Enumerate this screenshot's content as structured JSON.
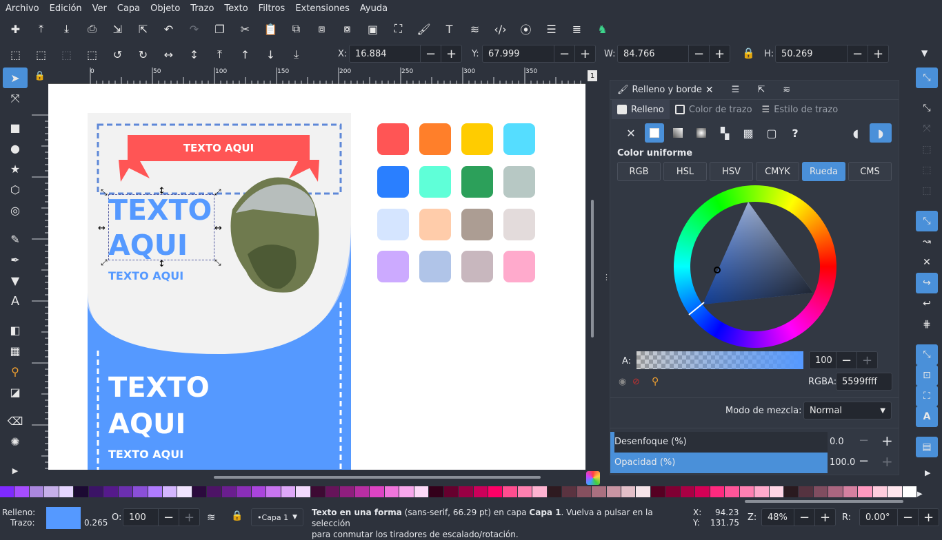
{
  "menu": [
    "Archivo",
    "Edición",
    "Ver",
    "Capa",
    "Objeto",
    "Trazo",
    "Texto",
    "Filtros",
    "Extensiones",
    "Ayuda"
  ],
  "toolbar": {
    "x_label": "X:",
    "x_value": "16.884",
    "y_label": "Y:",
    "y_value": "67.999",
    "w_label": "W:",
    "w_value": "84.766",
    "h_label": "H:",
    "h_value": "50.269"
  },
  "ruler": {
    "h_ticks": [
      "0",
      "50",
      "100",
      "150",
      "200",
      "250",
      "300",
      "350"
    ],
    "page_num": "1"
  },
  "canvas": {
    "banner_text": "TEXTO AQUI",
    "title_text_1": "TEXTO",
    "title_text_2": "AQUI",
    "subtitle_text": "TEXTO AQUI",
    "bottom_title_1": "TEXTO",
    "bottom_title_2": "AQUI",
    "bottom_subtitle": "TEXTO AQUI",
    "swatches": [
      "#ff5555",
      "#ff7f2a",
      "#ffcc00",
      "#55ddff",
      "#2a7fff",
      "#5fffd8",
      "#2ca05a",
      "#b7c8c4",
      "#d5e5ff",
      "#ffccaa",
      "#ac9d93",
      "#e3dbdb",
      "#ccaaff",
      "#b0c4e8",
      "#c8b7be",
      "#ffaacc"
    ]
  },
  "panel": {
    "tab_title": "Relleno y borde",
    "subtabs": [
      "Relleno",
      "Color de trazo",
      "Estilo de trazo"
    ],
    "section": "Color uniforme",
    "color_modes": [
      "RGB",
      "HSL",
      "HSV",
      "CMYK",
      "Rueda",
      "CMS"
    ],
    "active_mode": "Rueda",
    "alpha_label": "A:",
    "alpha_value": "100",
    "rgba_label": "RGBA:",
    "rgba_value": "5599ffff",
    "blend_label": "Modo de mezcla:",
    "blend_value": "Normal",
    "blur_label": "Desenfoque (%)",
    "blur_value": "0.0",
    "opacity_label": "Opacidad (%)",
    "opacity_value": "100.0",
    "opacity_fraction": 1.0,
    "fill_color": "#5599ff"
  },
  "status": {
    "fill_label": "Relleno:",
    "stroke_label": "Trazo:",
    "stroke_width": "0.265",
    "o_label": "O:",
    "o_value": "100",
    "layer": "•Capa 1",
    "msg_bold": "Texto en una forma",
    "msg_1": " (sans-serif, 66.29 pt) en capa ",
    "msg_layer": "Capa 1",
    "msg_2": ". Vuelva a pulsar en la selección",
    "msg_3": "para conmutar los tiradores de escalado/rotación.",
    "x_label": "X:",
    "x_value": "94.23",
    "y_label": "Y:",
    "y_value": "131.75",
    "z_label": "Z:",
    "z_value": "48%",
    "r_label": "R:",
    "r_value": "0.00°"
  },
  "palette_colors": [
    "#7f2aff",
    "#a64dff",
    "#aa87de",
    "#c6afe9",
    "#e5d5ff",
    "#1c0a33",
    "#3b1466",
    "#551a8b",
    "#6b2fb0",
    "#8a4fd8",
    "#b07cff",
    "#d4b6ff",
    "#f0e4ff",
    "#2b0a3d",
    "#4d1466",
    "#6a1e8f",
    "#8a2eb8",
    "#aa44dd",
    "#c875f0",
    "#dea7f8",
    "#f2d9fd",
    "#3d0a33",
    "#66145a",
    "#8f1e7e",
    "#b82ea3",
    "#dd44c4",
    "#f075dc",
    "#f8a7ec",
    "#fdd9f8",
    "#33001a",
    "#66002e",
    "#990044",
    "#cc005a",
    "#ff0066",
    "#ff4d8f",
    "#ff80b0",
    "#ffb3d1",
    "#2e1a20",
    "#5a3340",
    "#86505f",
    "#aa7080",
    "#c995a3",
    "#e3bfc8",
    "#f6e4e9",
    "#550022",
    "#800033",
    "#aa0044",
    "#d40055",
    "#ff2a7f",
    "#ff5599",
    "#ff80b2",
    "#ffaacc",
    "#ffd5e5",
    "#2a1a1f",
    "#553340",
    "#804d60",
    "#aa6680",
    "#d580a0",
    "#ff99c0",
    "#ffccdd",
    "#ffe6ee",
    "#ffffff"
  ]
}
